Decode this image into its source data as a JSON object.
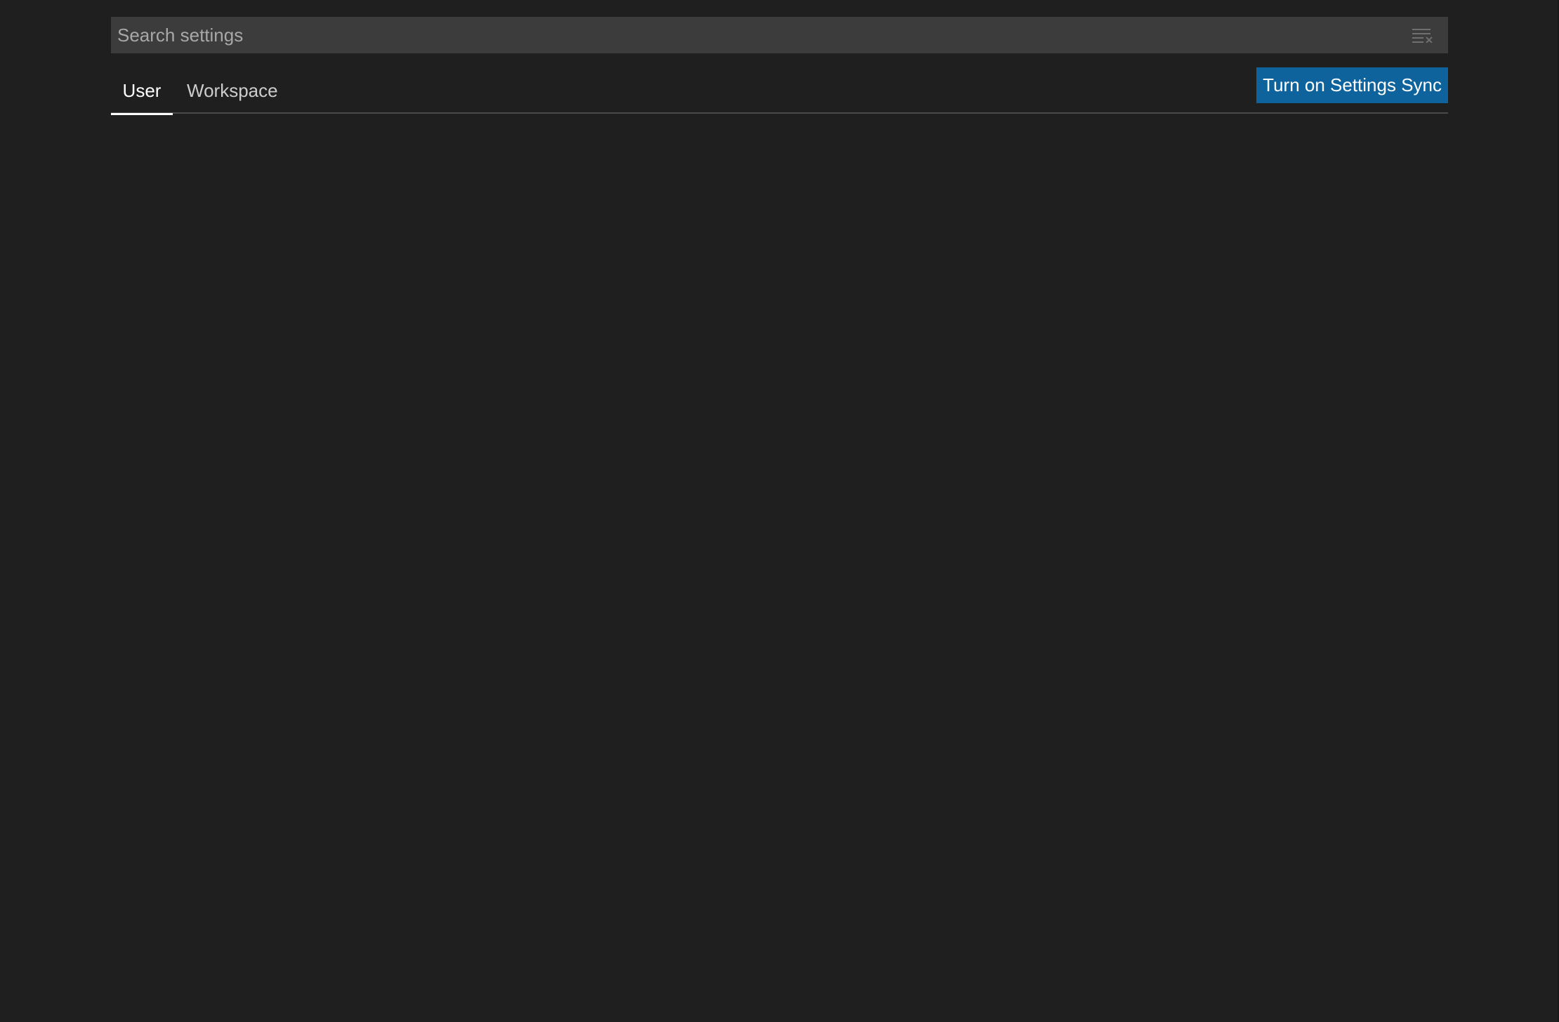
{
  "search": {
    "placeholder": "Search settings",
    "value": ""
  },
  "tabs": [
    {
      "label": "User",
      "active": true
    },
    {
      "label": "Workspace",
      "active": false
    }
  ],
  "sync_button": {
    "label": "Turn on Settings Sync"
  },
  "colors": {
    "background": "#1f1f1f",
    "input_background": "#3c3c3c",
    "button_background": "#0e639c",
    "active_tab": "#ffffff",
    "inactive_tab": "#cccccc"
  },
  "icons": {
    "clear_filter": "clear-filter-icon"
  }
}
